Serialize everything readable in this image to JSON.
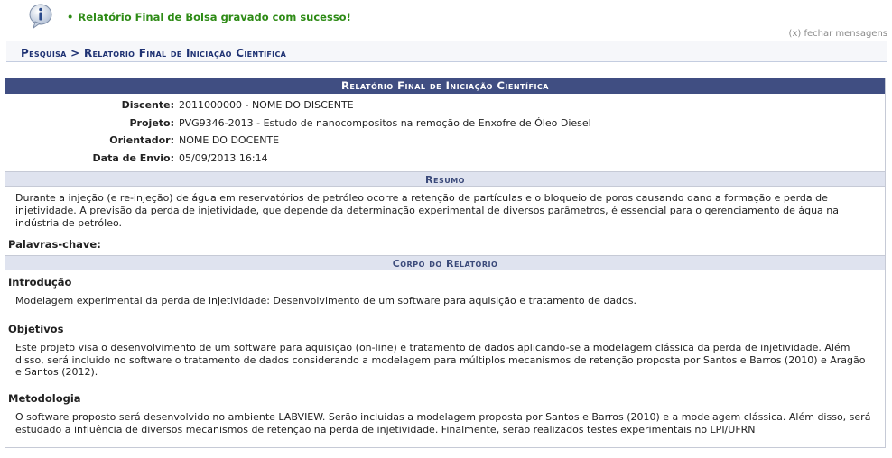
{
  "message": {
    "text": "Relatório Final de Bolsa gravado com sucesso!",
    "close_label": "(x) fechar mensagens"
  },
  "breadcrumb": "Pesquisa > Relatório Final de Iniciação Científica",
  "panel": {
    "title": "Relatório Final de Iniciação Científica",
    "fields": [
      {
        "label": "Discente:",
        "value": "2011000000 - NOME DO DISCENTE"
      },
      {
        "label": "Projeto:",
        "value": "PVG9346-2013 - Estudo de nanocompositos na remoção de Enxofre de Óleo Diesel"
      },
      {
        "label": "Orientador:",
        "value": "NOME DO DOCENTE"
      },
      {
        "label": "Data de Envio:",
        "value": "05/09/2013 16:14"
      }
    ],
    "resumo_title": "Resumo",
    "resumo_text": "Durante a injeção (e re-injeção) de água em reservatórios de petróleo ocorre a retenção de partículas e o bloqueio de poros causando dano a formação e perda de injetividade. A previsão da perda de injetividade, que depende da determinação experimental de diversos parâmetros, é essencial para o gerenciamento de água na indústria de petróleo.",
    "keywords_label": "Palavras-chave:",
    "body_title": "Corpo do Relatório",
    "sections": [
      {
        "title": "Introdução",
        "text": "Modelagem experimental da perda de injetividade: Desenvolvimento de um software para aquisição e tratamento de dados."
      },
      {
        "title": "Objetivos",
        "text": "Este projeto visa o desenvolvimento de um software para aquisição (on-line) e tratamento de dados aplicando-se a modelagem clássica da perda de injetividade. Além disso, será incluido no software o tratamento de dados considerando a modelagem para múltiplos mecanismos de retenção proposta por Santos e Barros (2010) e Aragão e Santos (2012)."
      },
      {
        "title": "Metodologia",
        "text": "O software proposto será desenvolvido no ambiente LABVIEW. Serão incluidas a modelagem proposta por Santos e Barros (2010) e a modelagem clássica. Além disso, será estudado a influência de diversos mecanismos de retenção na perda de injetividade. Finalmente, serão realizados testes experimentais no LPI/UFRN"
      }
    ]
  }
}
